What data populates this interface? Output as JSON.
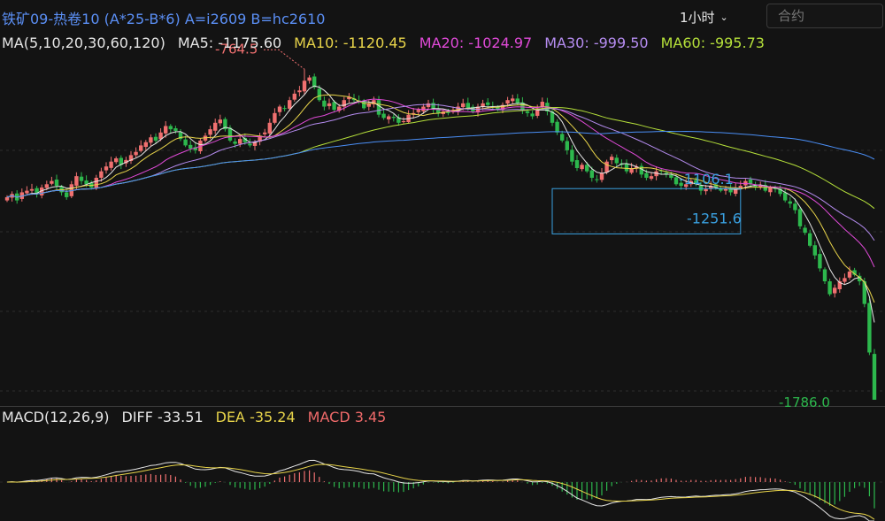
{
  "header": {
    "title": "铁矿09-热卷10 (A*25-B*6) A=i2609 B=hc2610",
    "period_label": "1小时",
    "search_placeholder": "合约"
  },
  "ma_legend": {
    "label": "MA(5,10,20,30,60,120)",
    "items": [
      {
        "text": "MA5: -1175.60",
        "color": "#e6e6e6"
      },
      {
        "text": "MA10: -1120.45",
        "color": "#e8d44a"
      },
      {
        "text": "MA20: -1024.97",
        "color": "#e04ad8"
      },
      {
        "text": "MA30: -999.50",
        "color": "#b58cf0"
      },
      {
        "text": "MA60: -995.73",
        "color": "#b5e03a"
      }
    ]
  },
  "macd_legend": {
    "label": "MACD(12,26,9)",
    "items": [
      {
        "text": "DIFF -33.51",
        "color": "#e6e6e6"
      },
      {
        "text": "DEA -35.24",
        "color": "#e8d44a"
      },
      {
        "text": "MACD 3.45",
        "color": "#f06a6a"
      }
    ]
  },
  "annotations": {
    "high_label": "-764.5",
    "low_label": "-1786.0",
    "box_top_label": "-1106.1",
    "box_bottom_label": "-1251.6"
  },
  "colors": {
    "up": "#f07070",
    "down": "#2db84d",
    "ma5": "#e6e6e6",
    "ma10": "#e8d44a",
    "ma20": "#e04ad8",
    "ma30": "#b58cf0",
    "ma60": "#b5e03a",
    "ma120": "#4a8ef5",
    "box": "#3aa0e0"
  },
  "chart_data": {
    "type": "candlestick",
    "ylim": [
      -1800,
      -720
    ],
    "close": [
      -1160,
      -1150,
      -1170,
      -1145,
      -1140,
      -1135,
      -1150,
      -1130,
      -1120,
      -1110,
      -1125,
      -1145,
      -1160,
      -1120,
      -1095,
      -1110,
      -1120,
      -1130,
      -1100,
      -1080,
      -1065,
      -1050,
      -1040,
      -1060,
      -1045,
      -1030,
      -1020,
      -1000,
      -990,
      -975,
      -985,
      -960,
      -940,
      -950,
      -955,
      -980,
      -1000,
      -1010,
      -1015,
      -985,
      -970,
      -950,
      -930,
      -920,
      -950,
      -985,
      -995,
      -980,
      -990,
      -1000,
      -990,
      -970,
      -960,
      -930,
      -900,
      -880,
      -885,
      -860,
      -840,
      -830,
      -800,
      -790,
      -820,
      -860,
      -880,
      -870,
      -890,
      -880,
      -860,
      -850,
      -860,
      -865,
      -885,
      -870,
      -860,
      -905,
      -915,
      -910,
      -915,
      -930,
      -925,
      -905,
      -900,
      -890,
      -880,
      -870,
      -890,
      -900,
      -895,
      -900,
      -890,
      -880,
      -870,
      -885,
      -895,
      -880,
      -870,
      -875,
      -880,
      -890,
      -875,
      -860,
      -855,
      -870,
      -890,
      -900,
      -910,
      -885,
      -865,
      -895,
      -930,
      -960,
      -985,
      -1015,
      -1050,
      -1070,
      -1060,
      -1080,
      -1100,
      -1105,
      -1085,
      -1050,
      -1035,
      -1055,
      -1060,
      -1080,
      -1070,
      -1065,
      -1090,
      -1100,
      -1095,
      -1080,
      -1080,
      -1090,
      -1100,
      -1120,
      -1125,
      -1120,
      -1110,
      -1120,
      -1140,
      -1135,
      -1125,
      -1130,
      -1140,
      -1135,
      -1145,
      -1130,
      -1125,
      -1110,
      -1120,
      -1130,
      -1125,
      -1140,
      -1130,
      -1135,
      -1150,
      -1170,
      -1180,
      -1200,
      -1250,
      -1270,
      -1310,
      -1340,
      -1380,
      -1420,
      -1460,
      -1440,
      -1420,
      -1410,
      -1390,
      -1400,
      -1420,
      -1490,
      -1640,
      -1786
    ]
  }
}
